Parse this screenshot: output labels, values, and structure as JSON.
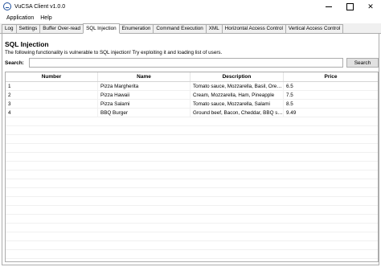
{
  "window": {
    "title": "VuCSA Client v1.0.0"
  },
  "menu": {
    "items": [
      {
        "label": "Application"
      },
      {
        "label": "Help"
      }
    ]
  },
  "tabs": [
    {
      "label": "Log"
    },
    {
      "label": "Settings"
    },
    {
      "label": "Buffer Over-read"
    },
    {
      "label": "SQL Injection",
      "active": true
    },
    {
      "label": "Enumeration"
    },
    {
      "label": "Command Execution"
    },
    {
      "label": "XML"
    },
    {
      "label": "Horizontal Access Control"
    },
    {
      "label": "Vertical Access Control"
    }
  ],
  "section": {
    "title": "SQL Injection",
    "description": "The following functionality is vulnerable to SQL injection! Try exploiting it and loading list of users."
  },
  "search": {
    "label": "Search:",
    "value": "",
    "button_label": "Search"
  },
  "table": {
    "columns": [
      "Number",
      "Name",
      "Description",
      "Price"
    ],
    "rows": [
      [
        "1",
        "Pizza Margherita",
        "Tomato sauce, Mozzarella, Basil, Oregano",
        "6.5"
      ],
      [
        "2",
        "Pizza Hawaii",
        "Cream, Mozzarella, Ham, Pineapple",
        "7.5"
      ],
      [
        "3",
        "Pizza Salami",
        "Tomato sauce, Mozzarella, Salami",
        "8.5"
      ],
      [
        "4",
        "BBQ Burger",
        "Ground beef, Bacon, Cheddar, BBQ sauce",
        "9.49"
      ]
    ]
  }
}
